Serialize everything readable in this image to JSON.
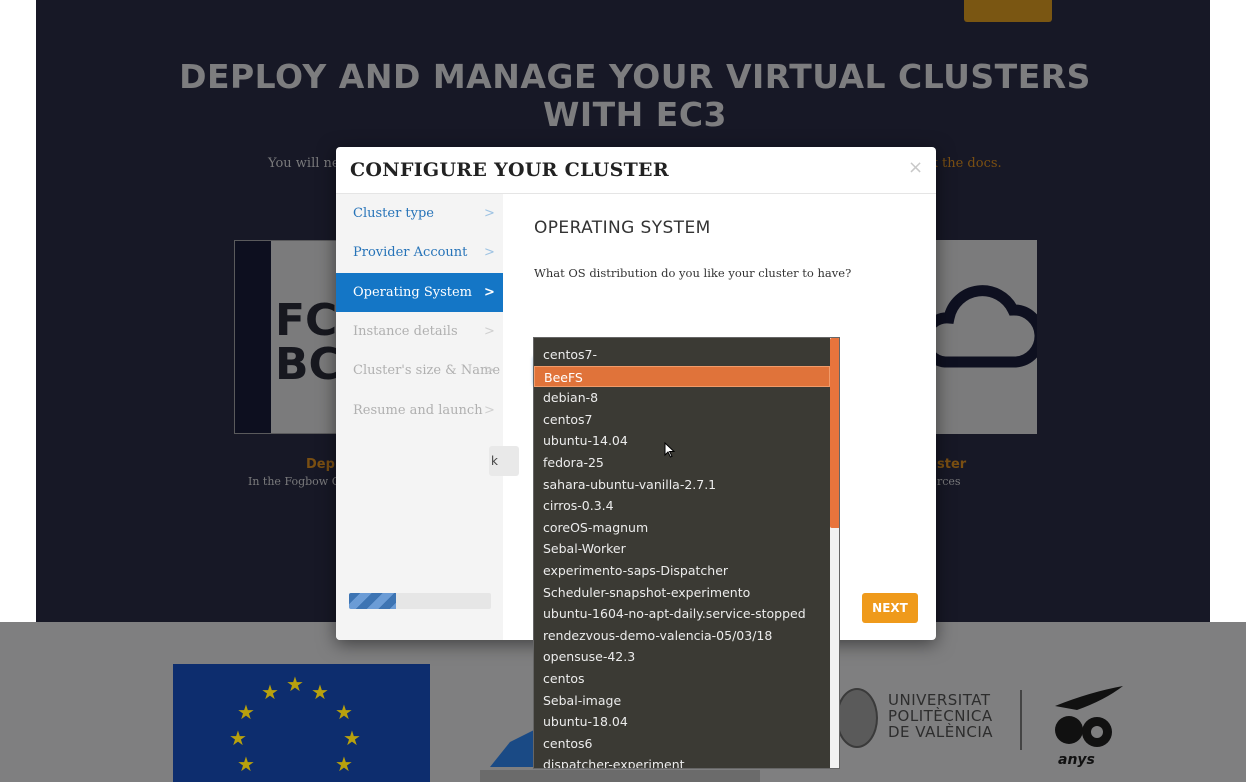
{
  "background_page": {
    "hero_title_line1": "DEPLOY AND MANAGE YOUR VIRTUAL CLUSTERS",
    "hero_title_line2": "WITH EC3",
    "subtitle_left": "You will ne",
    "subtitle_right": "k the docs.",
    "left_card_logo_line1": "FC",
    "left_card_logo_line2": "BC",
    "left_card_label": "Dep",
    "left_card_sub": "In the Fogbow C",
    "right_card_label": "ster",
    "right_card_sub": "rces",
    "upv_line1": "UNIVERSITAT",
    "upv_line2": "POLITÈCNICA",
    "upv_line3": "DE VALÈNCIA",
    "anys_label": "anys"
  },
  "modal": {
    "title": "CONFIGURE YOUR CLUSTER",
    "close_label": "×",
    "steps": [
      {
        "label": "Cluster type",
        "state": "done"
      },
      {
        "label": "Provider Account",
        "state": "done"
      },
      {
        "label": "Operating System",
        "state": "active"
      },
      {
        "label": "Instance details",
        "state": "disabled"
      },
      {
        "label": "Cluster's size & Name",
        "state": "disabled"
      },
      {
        "label": "Resume and launch",
        "state": "disabled"
      }
    ],
    "chevron": ">",
    "progress_fraction": 0.33,
    "section_title": "OPERATING SYSTEM",
    "question": "What OS distribution do you like your cluster to have?",
    "select_value": "",
    "back_label": "k",
    "next_label": "NEXT"
  },
  "dropdown": {
    "selected_index": 1,
    "items": [
      "centos7-",
      "BeeFS",
      "debian-8",
      "centos7",
      "ubuntu-14.04",
      "fedora-25",
      "sahara-ubuntu-vanilla-2.7.1",
      "cirros-0.3.4",
      "coreOS-magnum",
      "Sebal-Worker",
      "experimento-saps-Dispatcher",
      "Scheduler-snapshot-experimento",
      "ubuntu-1604-no-apt-daily.service-stopped",
      "rendezvous-demo-valencia-05/03/18",
      "opensuse-42.3",
      "centos",
      "Sebal-image",
      "ubuntu-18.04",
      "centos6",
      "dispatcher-experiment"
    ],
    "scroll_fraction": 0.44
  },
  "colors": {
    "active_step": "#1476c6",
    "selected_item": "#e0733a",
    "next_button": "#ef9a1b",
    "dropdown_bg": "#3b3a34"
  }
}
